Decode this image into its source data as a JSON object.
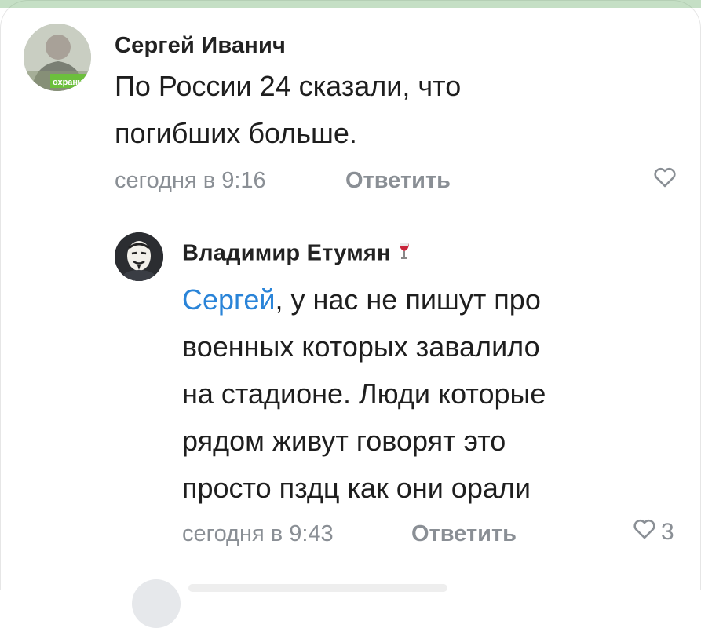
{
  "comments": [
    {
      "author": "Сергей Иванич",
      "avatar_label": "охраниТ",
      "text_lines": [
        "По России 24 сказали, что",
        "погибших больше."
      ],
      "timestamp": "сегодня в 9:16",
      "reply_label": "Ответить",
      "likes": ""
    },
    {
      "author": "Владимир Етумян",
      "mention": "Сергей",
      "first_line_rest": ", у нас не пишут про",
      "text_lines": [
        "военных которых завалило",
        "на стадионе. Люди которые",
        "рядом живут говорят это",
        "просто пздц как они орали"
      ],
      "timestamp": "сегодня в 9:43",
      "reply_label": "Ответить",
      "likes": "3"
    }
  ],
  "icons": {
    "like": "heart-outline-icon",
    "badge": "wine-glass-icon"
  },
  "colors": {
    "mention": "#2a84d8",
    "meta": "#8a8f95",
    "text": "#1e1e1e"
  }
}
